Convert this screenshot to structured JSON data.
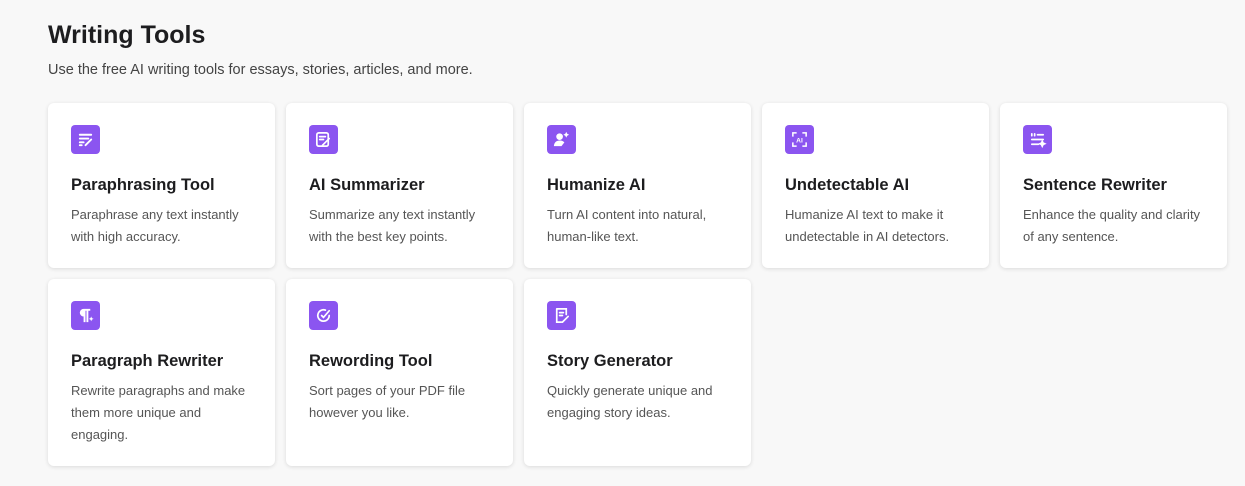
{
  "header": {
    "title": "Writing Tools",
    "subtitle": "Use the free AI writing tools for essays, stories, articles, and more."
  },
  "accent": "#8b55f0",
  "tools": [
    {
      "title": "Paraphrasing Tool",
      "desc": "Paraphrase any text instantly with high accuracy.",
      "icon": "paraphrase-icon"
    },
    {
      "title": "AI Summarizer",
      "desc": "Summarize any text instantly with the best key points.",
      "icon": "summarizer-icon"
    },
    {
      "title": "Humanize AI",
      "desc": "Turn AI content into natural, human-like text.",
      "icon": "humanize-icon"
    },
    {
      "title": "Undetectable AI",
      "desc": "Humanize AI text to make it undetectable in AI detectors.",
      "icon": "ai-scan-icon"
    },
    {
      "title": "Sentence Rewriter",
      "desc": "Enhance the quality and clarity of any sentence.",
      "icon": "sentence-icon"
    },
    {
      "title": "Paragraph Rewriter",
      "desc": "Rewrite paragraphs and make them more unique and engaging.",
      "icon": "paragraph-icon"
    },
    {
      "title": "Rewording Tool",
      "desc": "Sort pages of your PDF file however you like.",
      "icon": "reword-icon"
    },
    {
      "title": "Story Generator",
      "desc": "Quickly generate unique and engaging story ideas.",
      "icon": "story-icon"
    }
  ]
}
